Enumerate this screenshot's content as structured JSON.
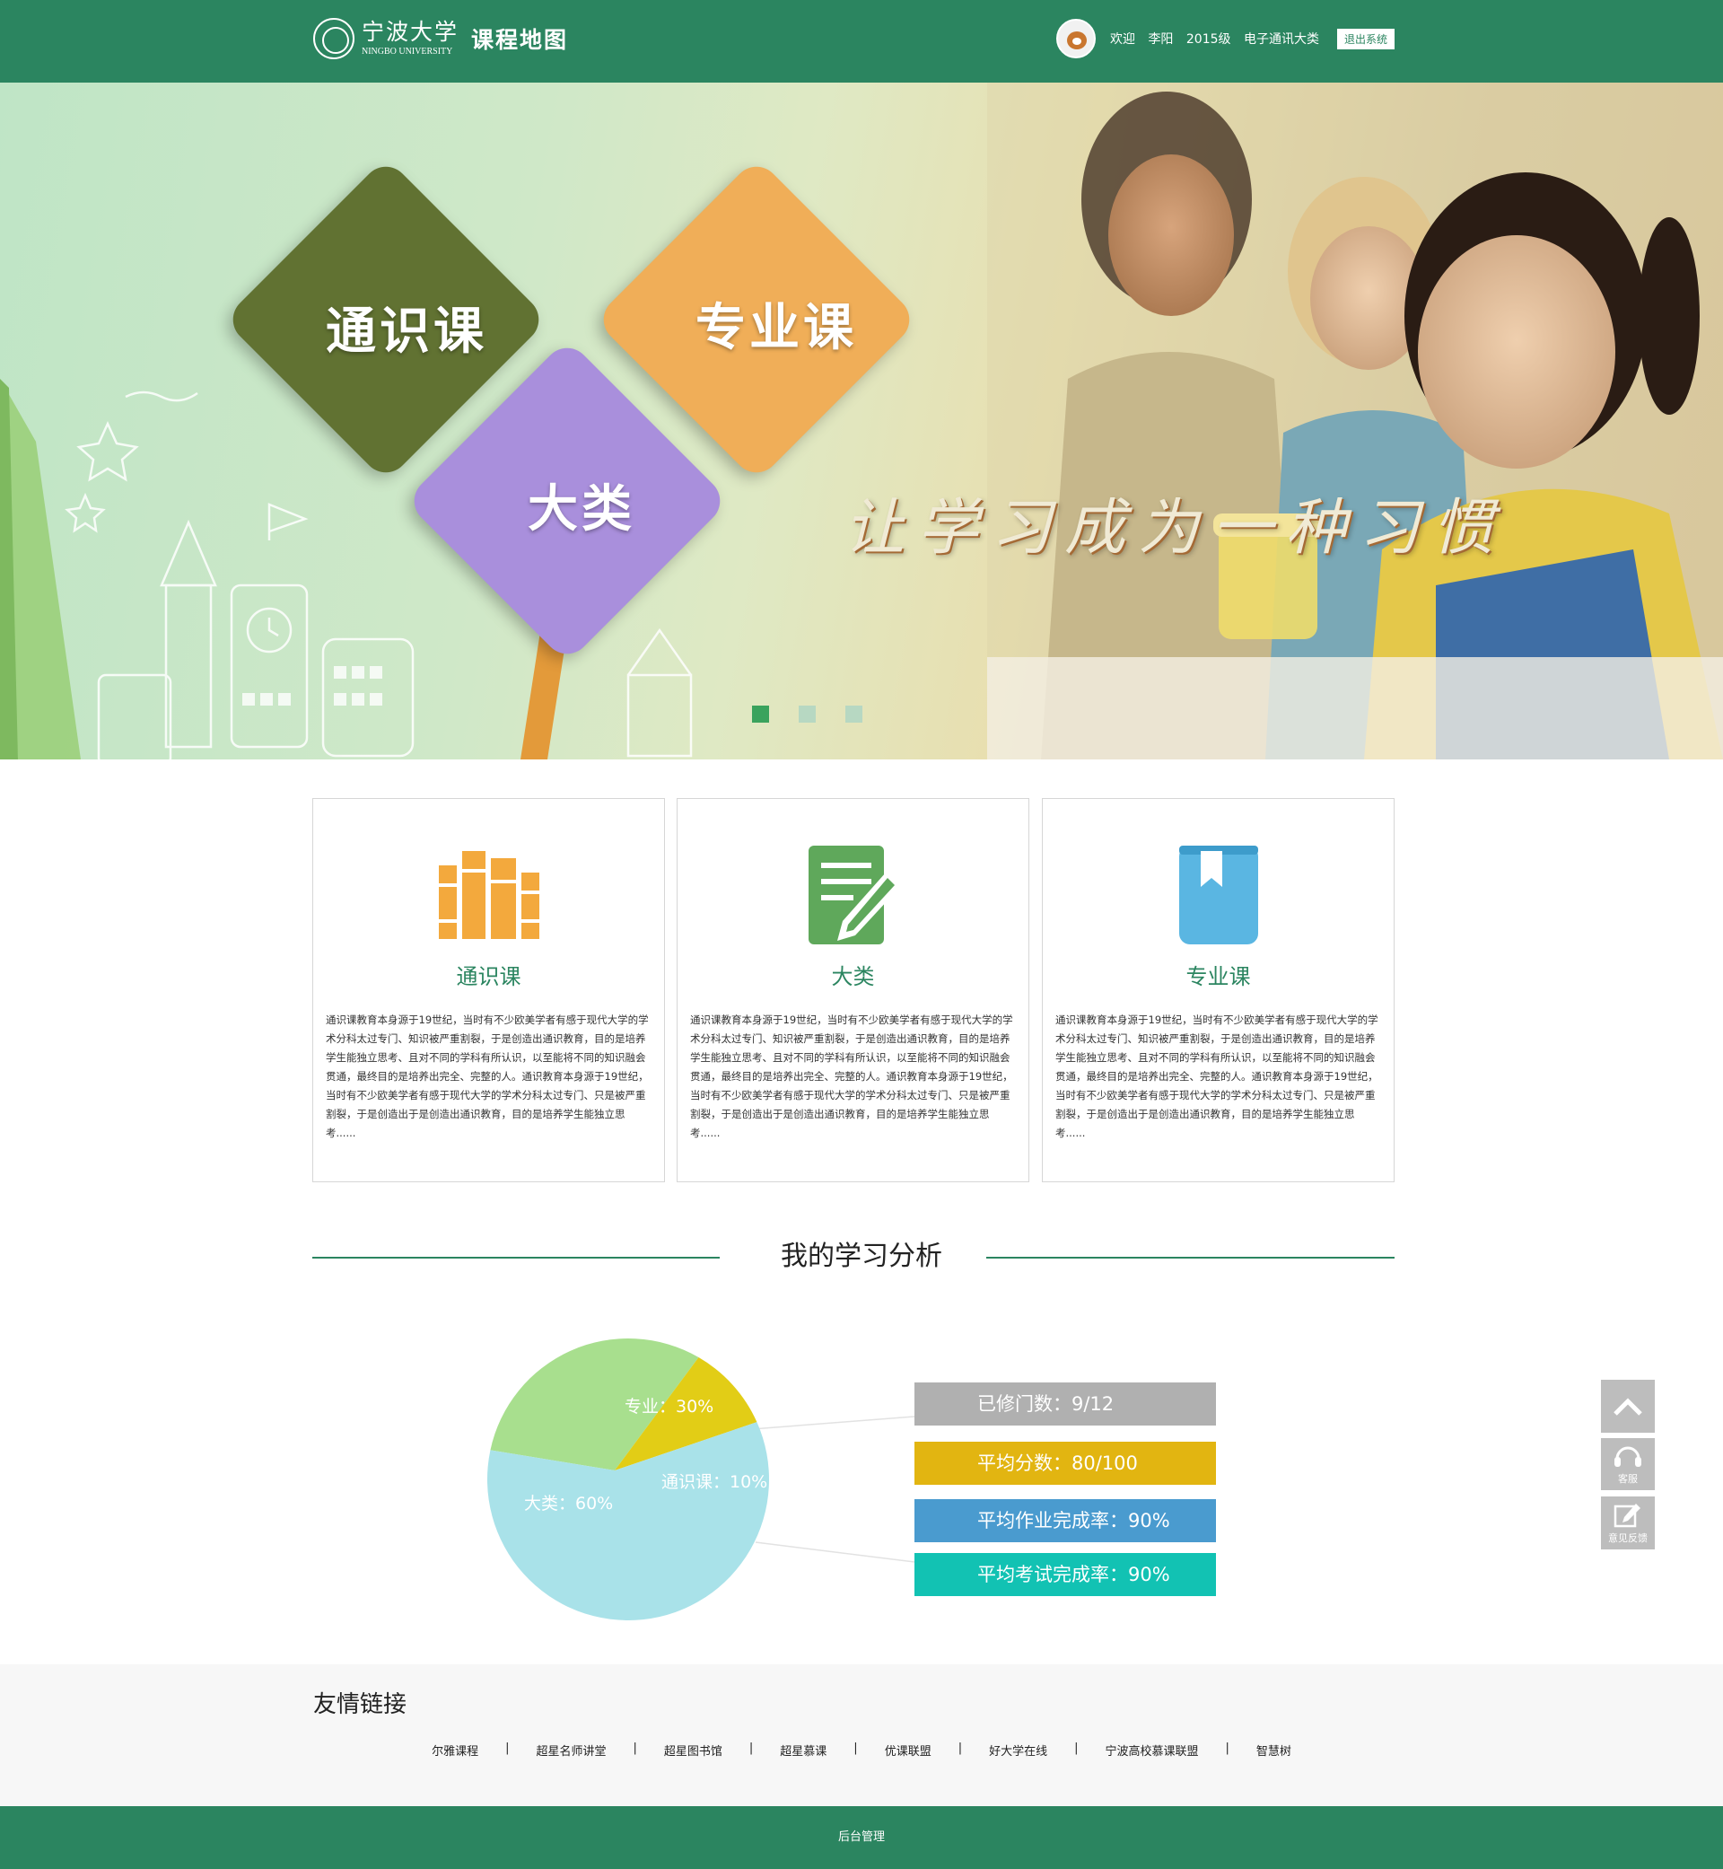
{
  "header": {
    "logo_cn": "宁波大学",
    "logo_en": "NINGBO UNIVERSITY",
    "site_title": "课程地图",
    "welcome": "欢迎",
    "user_name": "李阳",
    "grade": "2015级",
    "major": "电子通讯大类",
    "logout_label": "退出系统"
  },
  "banner": {
    "diamonds": {
      "general": "通识课",
      "major": "专业课",
      "category": "大类"
    },
    "slogan": "让学习成为一种习惯",
    "slide_count": 3,
    "active_slide": 1
  },
  "cards": [
    {
      "title": "通识课",
      "icon": "books-icon",
      "color": "#f3a93d",
      "text": "通识课教育本身源于19世纪，当时有不少欧美学者有感于现代大学的学术分科太过专门、知识被严重割裂，于是创造出通识教育，目的是培养学生能独立思考、且对不同的学科有所认识，以至能将不同的知识融会贯通，最终目的是培养出完全、完整的人。通识教育本身源于19世纪，当时有不少欧美学者有感于现代大学的学术分科太过专门、只是被严重割裂，于是创造出于是创造出通识教育，目的是培养学生能独立思考......"
    },
    {
      "title": "大类",
      "icon": "document-edit-icon",
      "color": "#5fa85b",
      "text": "通识课教育本身源于19世纪，当时有不少欧美学者有感于现代大学的学术分科太过专门、知识被严重割裂，于是创造出通识教育，目的是培养学生能独立思考、且对不同的学科有所认识，以至能将不同的知识融会贯通，最终目的是培养出完全、完整的人。通识教育本身源于19世纪，当时有不少欧美学者有感于现代大学的学术分科太过专门、只是被严重割裂，于是创造出于是创造出通识教育，目的是培养学生能独立思考......"
    },
    {
      "title": "专业课",
      "icon": "bookmark-book-icon",
      "color": "#5ab6e2",
      "text": "通识课教育本身源于19世纪，当时有不少欧美学者有感于现代大学的学术分科太过专门、知识被严重割裂，于是创造出通识教育，目的是培养学生能独立思考、且对不同的学科有所认识，以至能将不同的知识融会贯通，最终目的是培养出完全、完整的人。通识教育本身源于19世纪，当时有不少欧美学者有感于现代大学的学术分科太过专门、只是被严重割裂，于是创造出于是创造出通识教育，目的是培养学生能独立思考......"
    }
  ],
  "analysis": {
    "title": "我的学习分析",
    "stats": [
      {
        "label": "已修门数：9/12",
        "color": "#b0b0b0"
      },
      {
        "label": "平均分数：80/100",
        "color": "#e2b511"
      },
      {
        "label": "平均作业完成率：90%",
        "color": "#4a9bcf"
      },
      {
        "label": "平均考试完成率：90%",
        "color": "#12c2b3"
      }
    ]
  },
  "chart_data": {
    "type": "pie",
    "slices": [
      {
        "name": "专业",
        "value": 30,
        "label": "专业：30%",
        "color": "#a8df8e"
      },
      {
        "name": "通识课",
        "value": 10,
        "label": "通识课：10%",
        "color": "#e2cd16"
      },
      {
        "name": "大类",
        "value": 60,
        "label": "大类：60%",
        "color": "#a9e2e9"
      }
    ]
  },
  "side_tools": {
    "top_icon": "chevron-up-icon",
    "service_label": "客服",
    "feedback_label": "意见反馈"
  },
  "links": {
    "title": "友情链接",
    "items": [
      "尔雅课程",
      "超星名师讲堂",
      "超星图书馆",
      "超星慕课",
      "优课联盟",
      "好大学在线",
      "宁波高校慕课联盟",
      "智慧树"
    ]
  },
  "footer": {
    "admin_label": "后台管理"
  }
}
